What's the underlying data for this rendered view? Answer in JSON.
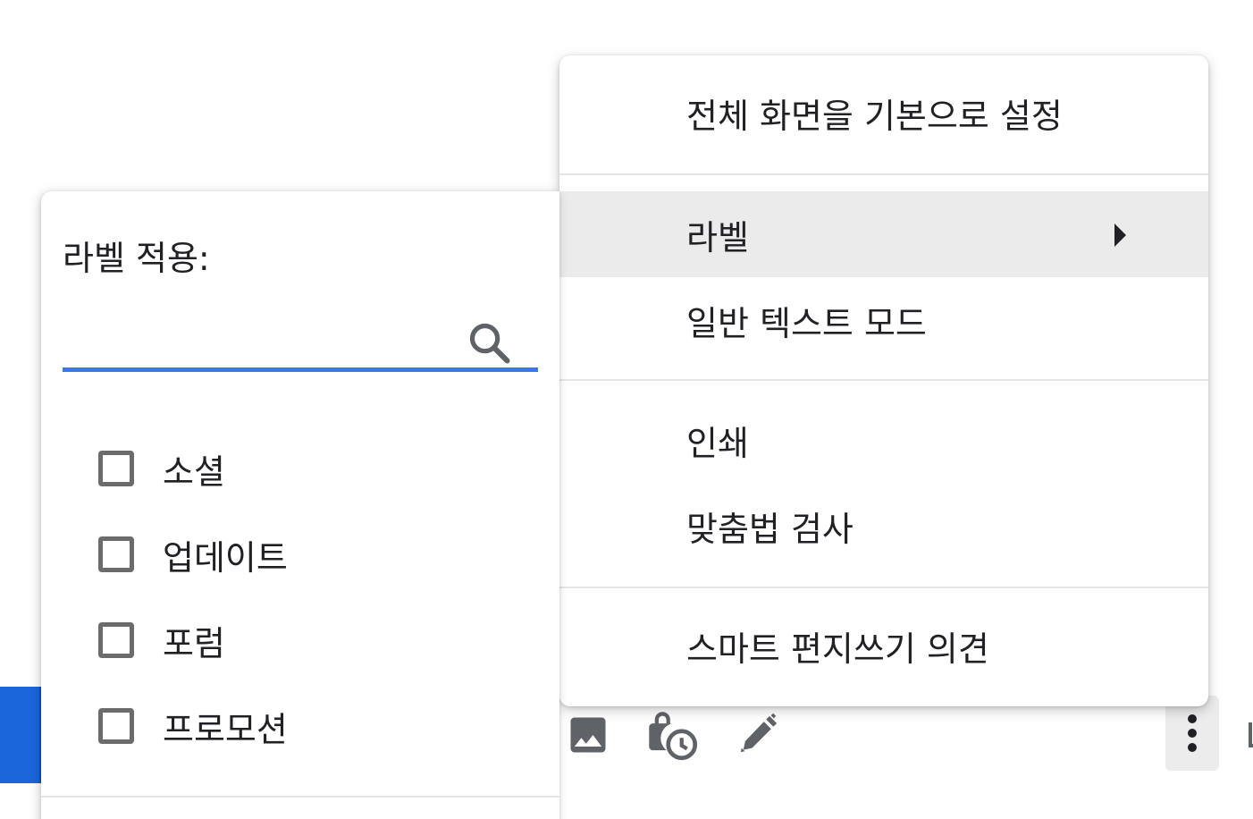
{
  "main_menu": {
    "items": [
      {
        "label": "전체 화면을 기본으로 설정"
      },
      {
        "label": "라벨"
      },
      {
        "label": "일반 텍스트 모드"
      },
      {
        "label": "인쇄"
      },
      {
        "label": "맞춤법 검사"
      },
      {
        "label": "스마트 편지쓰기 의견"
      }
    ]
  },
  "label_panel": {
    "title": "라벨 적용:",
    "search": {
      "value": "",
      "placeholder": ""
    },
    "labels": [
      {
        "name": "소셜",
        "checked": false
      },
      {
        "name": "업데이트",
        "checked": false
      },
      {
        "name": "포럼",
        "checked": false
      },
      {
        "name": "프로모션",
        "checked": false
      }
    ]
  },
  "toolbar": {
    "icons": [
      "insert-photo-icon",
      "confidential-mode-icon",
      "signature-pen-icon",
      "more-options-icon"
    ]
  },
  "colors": {
    "accent_blue": "#3b78e7",
    "send_button_blue": "#1a66db",
    "highlight_gray": "#ebebeb",
    "icon_gray": "#6b6b6b"
  }
}
